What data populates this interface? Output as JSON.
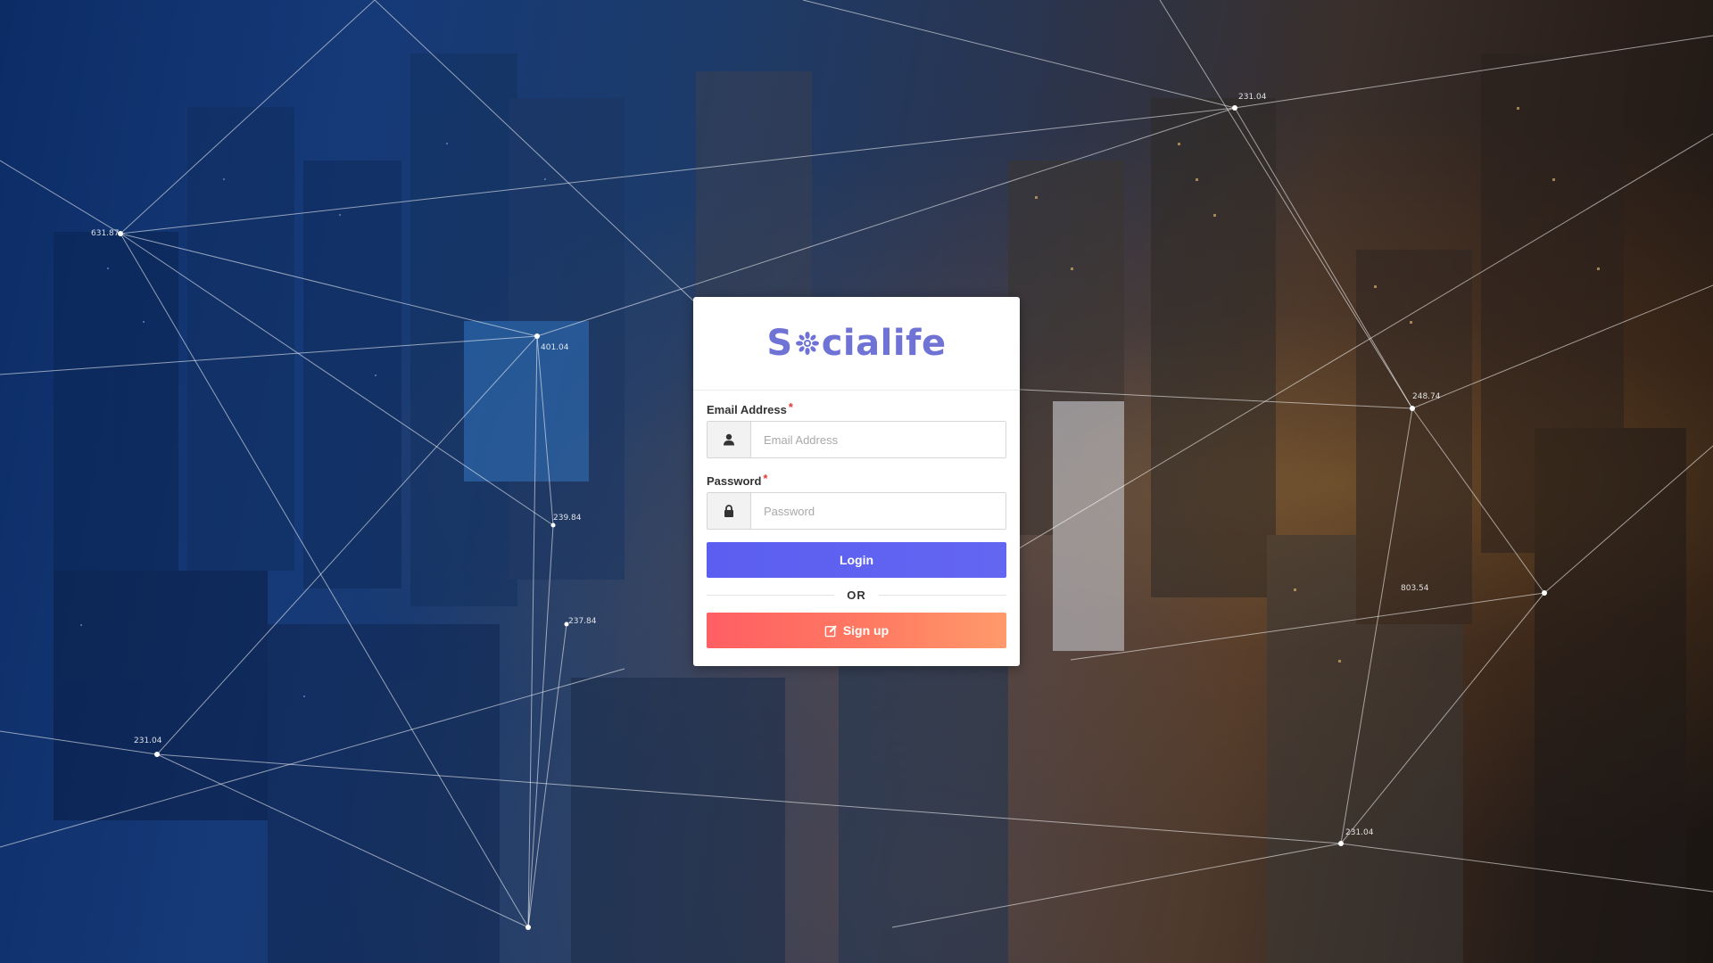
{
  "app": {
    "logo_text_prefix": "S",
    "logo_text_suffix": "cialife",
    "logo_color": "#6f73d6"
  },
  "form": {
    "email": {
      "label": "Email Address",
      "required_mark": "*",
      "placeholder": "Email Address",
      "value": "",
      "icon": "user-icon"
    },
    "password": {
      "label": "Password",
      "required_mark": "*",
      "placeholder": "Password",
      "value": "",
      "icon": "lock-icon"
    },
    "login_label": "Login",
    "divider_text": "OR",
    "signup_label": "Sign up",
    "signup_icon": "edit-icon"
  },
  "background": {
    "network_labels": [
      "231.04",
      "631.87",
      "401.04",
      "239.84",
      "237.84",
      "231.04",
      "248.74",
      "803.54",
      "231.04"
    ]
  },
  "colors": {
    "login_button": "#6366f1",
    "signup_button_start": "#ff5f63",
    "signup_button_end": "#ff9a6a",
    "required": "#e53935"
  }
}
